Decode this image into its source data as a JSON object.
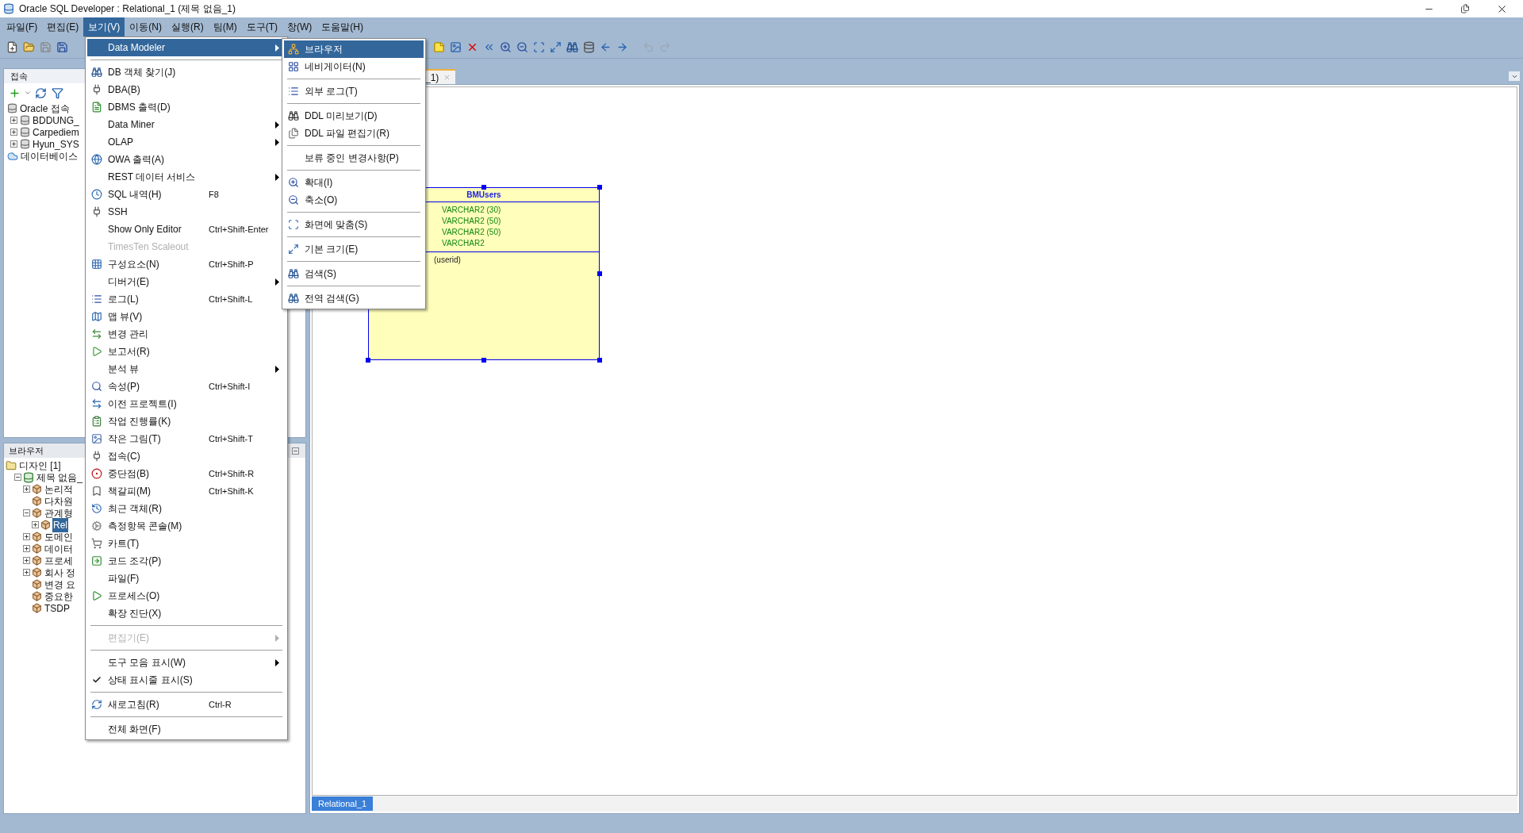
{
  "window": {
    "title": "Oracle SQL Developer : Relational_1 (제목 없음_1)"
  },
  "menu_bar": [
    {
      "label": "파일(F)",
      "selected": false
    },
    {
      "label": "편집(E)",
      "selected": false
    },
    {
      "label": "보기(V)",
      "selected": true
    },
    {
      "label": "이동(N)",
      "selected": false
    },
    {
      "label": "실행(R)",
      "selected": false
    },
    {
      "label": "팀(M)",
      "selected": false
    },
    {
      "label": "도구(T)",
      "selected": false
    },
    {
      "label": "창(W)",
      "selected": false
    },
    {
      "label": "도움말(H)",
      "selected": false
    }
  ],
  "connections_panel": {
    "title": "접속",
    "tree": [
      {
        "label": "Oracle 접속",
        "children": [
          {
            "label": "BDDUNG_",
            "expanded": false
          },
          {
            "label": "Carpediem",
            "expanded": false
          },
          {
            "label": "Hyun_SYS",
            "expanded": false
          }
        ]
      },
      {
        "label": "데이터베이스"
      }
    ]
  },
  "browser_panel": {
    "title": "브라우저",
    "tree": [
      {
        "label": "디자인 [1]",
        "selected": false,
        "children": [
          {
            "label": "제목 없음_",
            "selected": false,
            "expanded": true,
            "children": [
              {
                "label": "논리적",
                "selected": false,
                "expanded": false
              },
              {
                "label": "다차원",
                "selected": false
              },
              {
                "label": "관계형",
                "selected": false,
                "expanded": true,
                "children": [
                  {
                    "label": "Rel",
                    "selected": true,
                    "expanded": false
                  }
                ]
              },
              {
                "label": "도메인",
                "selected": false,
                "expanded": false
              },
              {
                "label": "데이터",
                "selected": false,
                "expanded": false
              },
              {
                "label": "프로세",
                "selected": false,
                "expanded": false
              },
              {
                "label": "회사 정",
                "selected": false,
                "expanded": false
              },
              {
                "label": "변경 요",
                "selected": false
              },
              {
                "label": "중요한",
                "selected": false
              },
              {
                "label": "TSDP",
                "selected": false
              }
            ]
          }
        ]
      }
    ]
  },
  "editor": {
    "tabs": [
      {
        "label": "_1)",
        "selected": true
      }
    ],
    "entity": {
      "name": "BMUsers",
      "columns": [
        "VARCHAR2 (30)",
        "VARCHAR2 (50)",
        "VARCHAR2 (50)",
        "VARCHAR2"
      ],
      "keys": [
        "(userid)"
      ]
    },
    "bottom_tabs": [
      {
        "label": "Relational_1",
        "selected": true
      }
    ]
  },
  "view_menu": {
    "items": [
      {
        "kind": "item",
        "label": "Data Modeler",
        "selected": true,
        "disabled": false,
        "submenu": true
      },
      {
        "kind": "separator"
      },
      {
        "kind": "item",
        "label": "DB 객체 찾기(J)",
        "selected": false,
        "disabled": false,
        "submenu": false
      },
      {
        "kind": "item",
        "label": "DBA(B)",
        "selected": false,
        "disabled": false,
        "submenu": false
      },
      {
        "kind": "item",
        "label": "DBMS 출력(D)",
        "selected": false,
        "disabled": false,
        "submenu": false
      },
      {
        "kind": "item",
        "label": "Data Miner",
        "selected": false,
        "disabled": false,
        "submenu": true
      },
      {
        "kind": "item",
        "label": "OLAP",
        "selected": false,
        "disabled": false,
        "submenu": true
      },
      {
        "kind": "item",
        "label": "OWA 출력(A)",
        "selected": false,
        "disabled": false,
        "submenu": false
      },
      {
        "kind": "item",
        "label": "REST 데이터 서비스",
        "selected": false,
        "disabled": false,
        "submenu": true
      },
      {
        "kind": "item",
        "label": "SQL 내역(H)",
        "shortcut": "F8",
        "selected": false,
        "disabled": false,
        "submenu": false
      },
      {
        "kind": "item",
        "label": "SSH",
        "selected": false,
        "disabled": false,
        "submenu": false
      },
      {
        "kind": "item",
        "label": "Show Only Editor",
        "shortcut": "Ctrl+Shift-Enter",
        "selected": false,
        "disabled": false,
        "submenu": false
      },
      {
        "kind": "item",
        "label": "TimesTen Scaleout",
        "selected": false,
        "disabled": true,
        "submenu": false
      },
      {
        "kind": "item",
        "label": "구성요소(N)",
        "shortcut": "Ctrl+Shift-P",
        "selected": false,
        "disabled": false,
        "submenu": false
      },
      {
        "kind": "item",
        "label": "디버거(E)",
        "selected": false,
        "disabled": false,
        "submenu": true
      },
      {
        "kind": "item",
        "label": "로그(L)",
        "shortcut": "Ctrl+Shift-L",
        "selected": false,
        "disabled": false,
        "submenu": false
      },
      {
        "kind": "item",
        "label": "맵 뷰(V)",
        "selected": false,
        "disabled": false,
        "submenu": false
      },
      {
        "kind": "item",
        "label": "변경 관리",
        "selected": false,
        "disabled": false,
        "submenu": false
      },
      {
        "kind": "item",
        "label": "보고서(R)",
        "selected": false,
        "disabled": false,
        "submenu": false
      },
      {
        "kind": "item",
        "label": "분석 뷰",
        "selected": false,
        "disabled": false,
        "submenu": true
      },
      {
        "kind": "item",
        "label": "속성(P)",
        "shortcut": "Ctrl+Shift-I",
        "selected": false,
        "disabled": false,
        "submenu": false
      },
      {
        "kind": "item",
        "label": "이전 프로젝트(I)",
        "selected": false,
        "disabled": false,
        "submenu": false
      },
      {
        "kind": "item",
        "label": "작업 진행률(K)",
        "selected": false,
        "disabled": false,
        "submenu": false
      },
      {
        "kind": "item",
        "label": "작은 그림(T)",
        "shortcut": "Ctrl+Shift-T",
        "selected": false,
        "disabled": false,
        "submenu": false
      },
      {
        "kind": "item",
        "label": "접속(C)",
        "selected": false,
        "disabled": false,
        "submenu": false
      },
      {
        "kind": "item",
        "label": "중단점(B)",
        "shortcut": "Ctrl+Shift-R",
        "selected": false,
        "disabled": false,
        "submenu": false
      },
      {
        "kind": "item",
        "label": "책갈피(M)",
        "shortcut": "Ctrl+Shift-K",
        "selected": false,
        "disabled": false,
        "submenu": false
      },
      {
        "kind": "item",
        "label": "최근 객체(R)",
        "selected": false,
        "disabled": false,
        "submenu": false
      },
      {
        "kind": "item",
        "label": "측정항목 콘솔(M)",
        "selected": false,
        "disabled": false,
        "submenu": false
      },
      {
        "kind": "item",
        "label": "카트(T)",
        "selected": false,
        "disabled": false,
        "submenu": false
      },
      {
        "kind": "item",
        "label": "코드 조각(P)",
        "selected": false,
        "disabled": false,
        "submenu": false
      },
      {
        "kind": "item",
        "label": "파일(F)",
        "selected": false,
        "disabled": false,
        "submenu": false
      },
      {
        "kind": "item",
        "label": "프로세스(O)",
        "selected": false,
        "disabled": false,
        "submenu": false
      },
      {
        "kind": "item",
        "label": "확장 진단(X)",
        "selected": false,
        "disabled": false,
        "submenu": false
      },
      {
        "kind": "separator"
      },
      {
        "kind": "item",
        "label": "편집기(E)",
        "selected": false,
        "disabled": true,
        "submenu": true
      },
      {
        "kind": "separator"
      },
      {
        "kind": "item",
        "label": "도구 모음 표시(W)",
        "selected": false,
        "disabled": false,
        "submenu": true
      },
      {
        "kind": "item",
        "label": "상태 표시줄 표시(S)",
        "selected": false,
        "disabled": false,
        "submenu": false,
        "checked": true
      },
      {
        "kind": "separator"
      },
      {
        "kind": "item",
        "label": "새로고침(R)",
        "shortcut": "Ctrl-R",
        "selected": false,
        "disabled": false,
        "submenu": false
      },
      {
        "kind": "separator"
      },
      {
        "kind": "item",
        "label": "전체 화면(F)",
        "selected": false,
        "disabled": false,
        "submenu": false
      }
    ]
  },
  "data_modeler_submenu": {
    "items": [
      {
        "kind": "item",
        "label": "브라우저",
        "selected": true
      },
      {
        "kind": "item",
        "label": "네비게이터(N)",
        "selected": false
      },
      {
        "kind": "separator"
      },
      {
        "kind": "item",
        "label": "외부 로그(T)",
        "selected": false
      },
      {
        "kind": "separator"
      },
      {
        "kind": "item",
        "label": "DDL 미리보기(D)",
        "selected": false
      },
      {
        "kind": "item",
        "label": "DDL 파일 편집기(R)",
        "selected": false
      },
      {
        "kind": "separator"
      },
      {
        "kind": "item",
        "label": "보류 중인 변경사항(P)",
        "selected": false
      },
      {
        "kind": "separator"
      },
      {
        "kind": "item",
        "label": "확대(I)",
        "selected": false
      },
      {
        "kind": "item",
        "label": "축소(O)",
        "selected": false
      },
      {
        "kind": "separator"
      },
      {
        "kind": "item",
        "label": "화면에 맞춤(S)",
        "selected": false
      },
      {
        "kind": "separator"
      },
      {
        "kind": "item",
        "label": "기본 크기(E)",
        "selected": false
      },
      {
        "kind": "separator"
      },
      {
        "kind": "item",
        "label": "검색(S)",
        "selected": false
      },
      {
        "kind": "separator"
      },
      {
        "kind": "item",
        "label": "전역 검색(G)",
        "selected": false
      }
    ]
  }
}
